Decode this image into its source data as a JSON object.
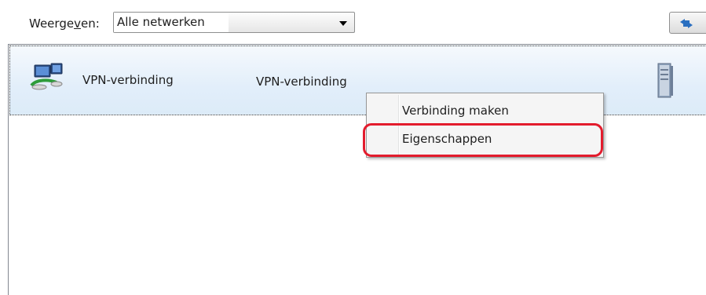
{
  "filter": {
    "label_prefix": "Weerge",
    "label_accel": "v",
    "label_suffix": "en:",
    "selected": "Alle netwerken"
  },
  "toolbar": {
    "refresh_icon": "refresh-icon"
  },
  "connections": [
    {
      "name": "VPN-verbinding",
      "type": "VPN-verbinding",
      "icon": "network-computer-icon",
      "status_icon": "server-icon"
    }
  ],
  "context_menu": {
    "items": [
      {
        "label": "Verbinding maken"
      },
      {
        "label": "Eigenschappen",
        "highlighted": true
      }
    ]
  },
  "colors": {
    "highlight": "#e31c2d",
    "row_selection": "#dcebf8"
  }
}
